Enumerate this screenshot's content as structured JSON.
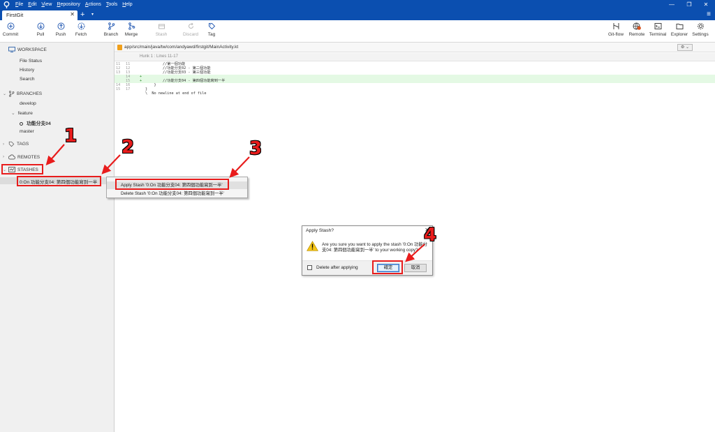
{
  "menubar": {
    "items": [
      "File",
      "Edit",
      "View",
      "Repository",
      "Actions",
      "Tools",
      "Help"
    ]
  },
  "window_controls": {
    "minimize": "—",
    "restore": "❐",
    "close": "✕"
  },
  "tabs": {
    "active_label": "FirstGit",
    "close_glyph": "✕",
    "add_glyph": "+",
    "more_glyph": "▾",
    "menu_glyph": "≡"
  },
  "toolbar": {
    "commit": "Commit",
    "pull": "Pull",
    "push": "Push",
    "fetch": "Fetch",
    "branch": "Branch",
    "merge": "Merge",
    "stash": "Stash",
    "discard": "Discard",
    "tag": "Tag",
    "gitflow": "Git-flow",
    "remote": "Remote",
    "terminal": "Terminal",
    "explorer": "Explorer",
    "settings": "Settings",
    "remote_badge": "!"
  },
  "sidebar": {
    "workspace_header": "WORKSPACE",
    "workspace_items": [
      "File Status",
      "History",
      "Search"
    ],
    "branches_header": "BRANCHES",
    "branch_develop": "develop",
    "branch_feature": "feature",
    "branch_current": "功能分支04",
    "branch_master": "master",
    "tags_header": "TAGS",
    "remotes_header": "REMOTES",
    "stashes_header": "STASHES",
    "stash_item": "0:On 功能分支04: 第四個功能寫到一半"
  },
  "main": {
    "file_path": "app/src/main/java/tw/com/andyawd/firstgit/MainActivity.kt",
    "gear_dropdown": "⚙ ⌄",
    "hunk_header": "Hunk 1 : Lines 11-17",
    "diff_lines": [
      {
        "old": "11",
        "new": "11",
        "marker": "",
        "code": "        //第一個功能",
        "added": false
      },
      {
        "old": "12",
        "new": "12",
        "marker": "",
        "code": "        //功能分支02 - 第二個功能",
        "added": false
      },
      {
        "old": "13",
        "new": "13",
        "marker": "",
        "code": "        //功能分支03 - 第三個功能",
        "added": false
      },
      {
        "old": "",
        "new": "14",
        "marker": "+",
        "code": "",
        "added": true
      },
      {
        "old": "",
        "new": "15",
        "marker": "+",
        "code": "        //功能分支04 - 第四個功能寫到一半",
        "added": true
      },
      {
        "old": "14",
        "new": "16",
        "marker": "",
        "code": "    }",
        "added": false
      },
      {
        "old": "15",
        "new": "17",
        "marker": "",
        "code": "}",
        "added": false
      },
      {
        "old": "",
        "new": "",
        "marker": "",
        "code": "\\  No newline at end of file",
        "added": false
      }
    ]
  },
  "context_menu": {
    "apply": "Apply Stash '0:On 功能分支04: 第四個功能寫到一半'",
    "delete": "Delete Stash '0:On 功能分支04: 第四個功能寫到一半'"
  },
  "dialog": {
    "title": "Apply Stash?",
    "close_glyph": "✕",
    "message": "Are you sure you want to apply the stash '0:On 功能分支04: 第四個功能寫到一半' to your working copy?",
    "checkbox_label": "Delete after applying",
    "ok": "確定",
    "cancel": "取消"
  },
  "annotations": {
    "step1": "1",
    "step2": "2",
    "step3": "3",
    "step4": "4",
    "color": "#e81c1c"
  }
}
